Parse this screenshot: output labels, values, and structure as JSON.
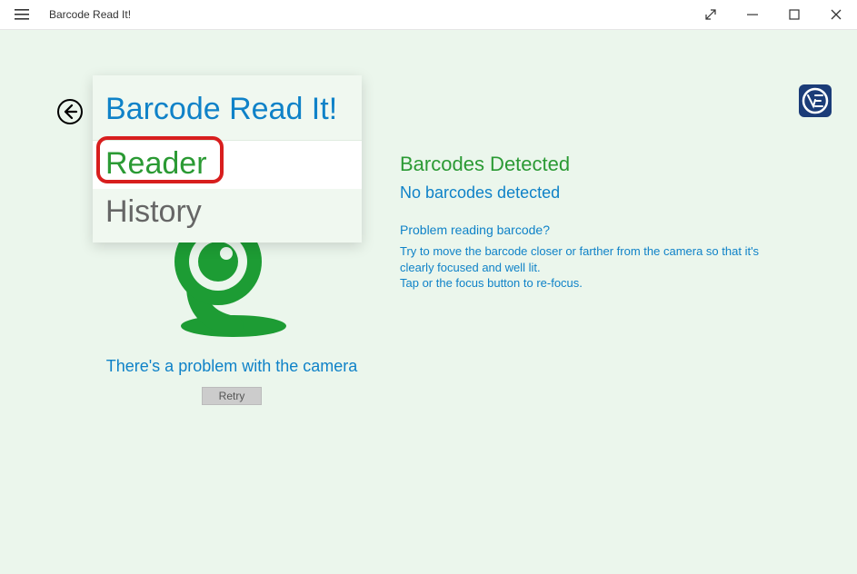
{
  "titlebar": {
    "title": "Barcode Read It!"
  },
  "back_button": {
    "label": "Back"
  },
  "menu": {
    "title": "Barcode Read It!",
    "items": [
      {
        "label": "Reader",
        "active": true
      },
      {
        "label": "History",
        "active": false
      }
    ]
  },
  "camera": {
    "problem_message": "There's a problem with the camera",
    "retry_label": "Retry"
  },
  "detected": {
    "heading": "Barcodes Detected",
    "status": "No barcodes detected",
    "help_question": "Problem reading barcode?",
    "help_body_line1": "Try to move the barcode closer or farther from the camera so that it's clearly focused and well lit.",
    "help_body_line2": "Tap or the focus button to re-focus."
  },
  "logo": {
    "name": "VE"
  }
}
